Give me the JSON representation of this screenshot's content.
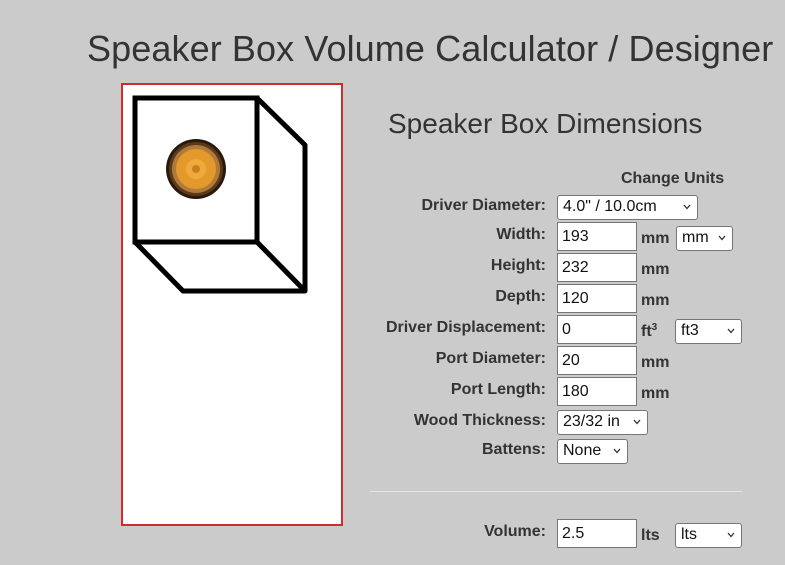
{
  "page": {
    "title": "Speaker Box Volume Calculator / Designer"
  },
  "form": {
    "title": "Speaker Box Dimensions",
    "change_units_label": "Change Units",
    "driver_diameter": {
      "label": "Driver Diameter:",
      "selected": "4.0\" / 10.0cm"
    },
    "width": {
      "label": "Width:",
      "value": "193",
      "unit": "mm",
      "unit_select": "mm"
    },
    "height": {
      "label": "Height:",
      "value": "232",
      "unit": "mm"
    },
    "depth": {
      "label": "Depth:",
      "value": "120",
      "unit": "mm"
    },
    "driver_displacement": {
      "label": "Driver Displacement:",
      "value": "0",
      "unit": "ft",
      "unit_sup": "3",
      "unit_select": "ft3"
    },
    "port_diameter": {
      "label": "Port Diameter:",
      "value": "20",
      "unit": "mm"
    },
    "port_length": {
      "label": "Port Length:",
      "value": "180",
      "unit": "mm"
    },
    "wood_thickness": {
      "label": "Wood Thickness:",
      "selected": "23/32 in"
    },
    "battens": {
      "label": "Battens:",
      "selected": "None"
    },
    "volume": {
      "label": "Volume:",
      "value": "2.5",
      "unit": "lts",
      "unit_select": "lts"
    }
  },
  "colors": {
    "background": "#cbcbcb",
    "panel_border": "#d12b2b",
    "text": "#333333",
    "driver_cone": "#e39a2b",
    "driver_rim": "#5a3a1a"
  },
  "icons": {
    "select_arrow": "chevron-down-icon",
    "box_preview": "speaker-box-icon",
    "driver": "speaker-driver-icon"
  }
}
